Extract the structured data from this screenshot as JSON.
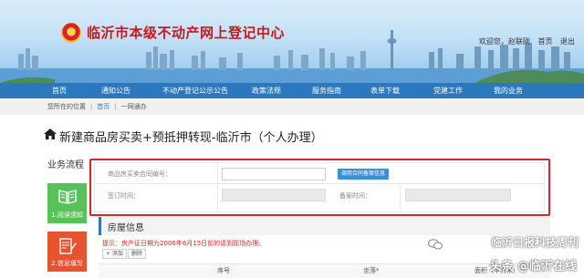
{
  "header": {
    "site_title": "临沂市本级不动产网上登记中心",
    "welcome": "欢迎您，赵联刚",
    "home": "首页",
    "logout": "退出"
  },
  "nav": {
    "items": [
      "首页",
      "通知公告",
      "不动产登记公示公告",
      "政策法规",
      "服务指南",
      "表单下载",
      "党建工作",
      "我的业务"
    ]
  },
  "breadcrumb": {
    "label": "您所在的位置",
    "home": "首页",
    "current": "一网通办"
  },
  "page": {
    "title": "新建商品房买卖+预抵押转现-临沂市（个人办理）"
  },
  "process": {
    "title": "业务流程",
    "steps": [
      "1.阅读须知",
      "2.信息填写"
    ]
  },
  "form": {
    "contract_label": "商品房买卖合同编号：",
    "contract_value": "",
    "query_button": "调用合同备案信息",
    "sign_time_label": "签订时间：",
    "record_time_label": "备案时间："
  },
  "house": {
    "title": "房屋信息",
    "tip": "提示：房产证日期为2006年6月15日前的请到现场办理。",
    "add_button": "+ 添加",
    "delete_button": "删除",
    "columns": [
      "序号",
      "坐落*",
      "面积（平方米）"
    ]
  },
  "watermark": {
    "line1": "临沂日报科技周刊",
    "line2": "头条 @临沂在线"
  },
  "colors": {
    "nav_bg": "#2b78be",
    "title_red": "#c8181e",
    "highlight_border": "#e02424"
  }
}
